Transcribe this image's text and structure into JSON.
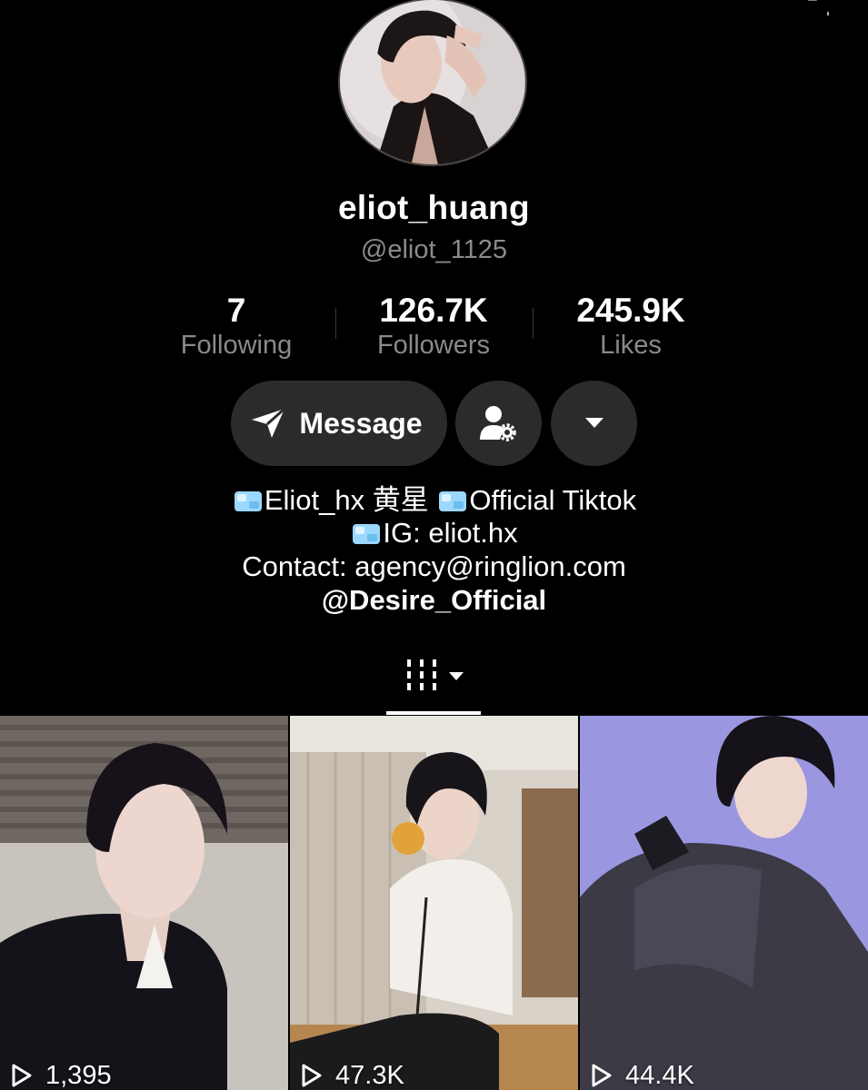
{
  "profile": {
    "display_name": "eliot_huang",
    "username": "@eliot_1125"
  },
  "stats": {
    "following": {
      "value": "7",
      "label": "Following"
    },
    "followers": {
      "value": "126.7K",
      "label": "Followers"
    },
    "likes": {
      "value": "245.9K",
      "label": "Likes"
    }
  },
  "actions": {
    "message_label": "Message"
  },
  "bio": {
    "line1_a": "Eliot_hx 黄星",
    "line1_b": "Official Tiktok",
    "line2": "IG: eliot.hx",
    "line3": "Contact: agency@ringlion.com",
    "line4": "@Desire_Official"
  },
  "icons": {
    "bio_emoji": "ice-cube-icon",
    "videos_tab": "grid-bars-icon",
    "dropdown": "caret-down-icon",
    "message": "send-icon",
    "user_settings": "user-gear-icon",
    "play": "play-outline-icon"
  },
  "videos": [
    {
      "views": "1,395"
    },
    {
      "views": "47.3K"
    },
    {
      "views": "44.4K"
    }
  ],
  "colors": {
    "background": "#000000",
    "button_bg": "#2b2b2b",
    "secondary_text": "#8a8a8a"
  }
}
